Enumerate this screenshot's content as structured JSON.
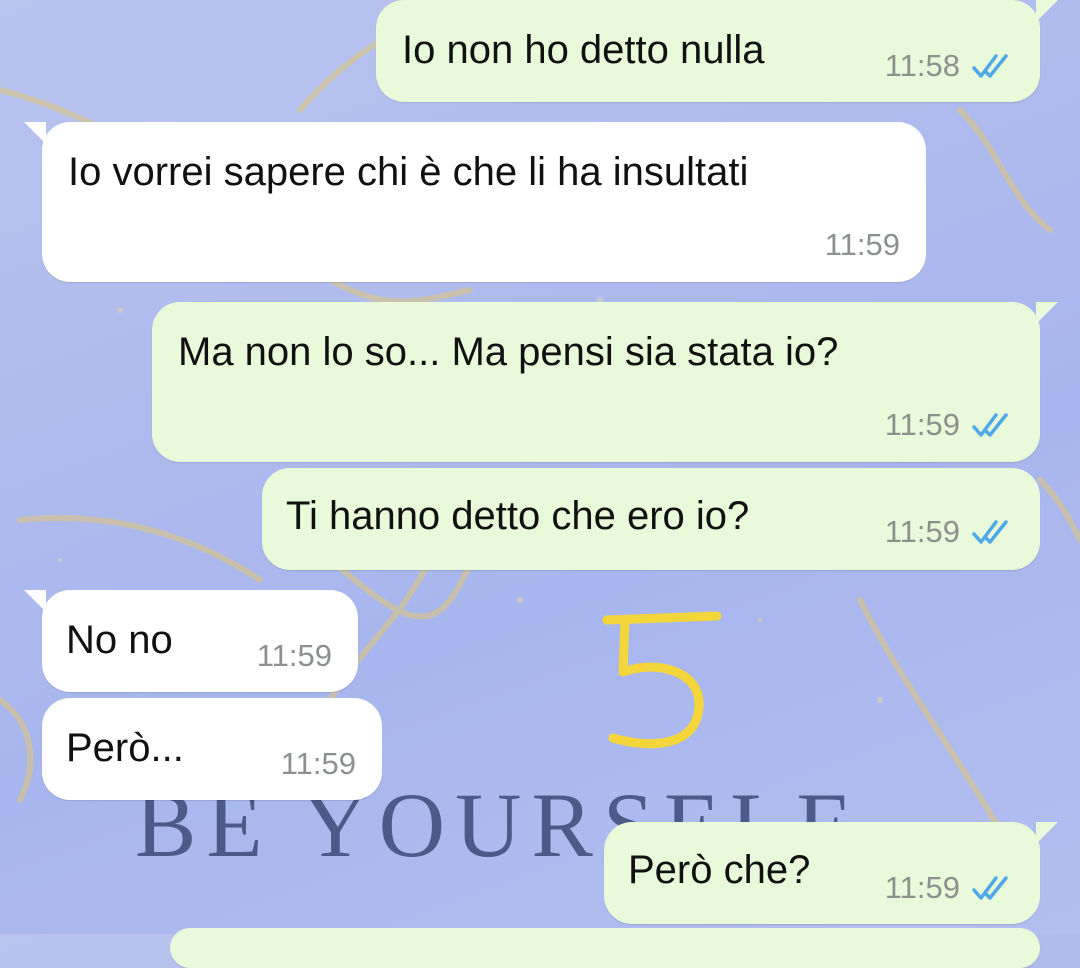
{
  "wallpaper": {
    "text": "BE YOURSELF"
  },
  "annotation": {
    "label": "5",
    "color": "#f5d63a"
  },
  "messages": [
    {
      "direction": "outgoing",
      "text": "Io non ho detto nulla",
      "time": "11:58",
      "status": "read"
    },
    {
      "direction": "incoming",
      "text": "Io vorrei sapere chi è che li ha insultati",
      "time": "11:59"
    },
    {
      "direction": "outgoing",
      "text": "Ma non lo so... Ma pensi sia stata io?",
      "time": "11:59",
      "status": "read"
    },
    {
      "direction": "outgoing",
      "text": "Ti hanno detto che ero io?",
      "time": "11:59",
      "status": "read"
    },
    {
      "direction": "incoming",
      "text": "No no",
      "time": "11:59"
    },
    {
      "direction": "incoming",
      "text": "Però...",
      "time": "11:59"
    },
    {
      "direction": "outgoing",
      "text": "Però che?",
      "time": "11:59",
      "status": "read"
    }
  ],
  "colors": {
    "incoming_bubble": "#ffffff",
    "outgoing_bubble": "#e8fad9",
    "read_ticks": "#4fa9e8",
    "timestamp": "#8d918e"
  }
}
